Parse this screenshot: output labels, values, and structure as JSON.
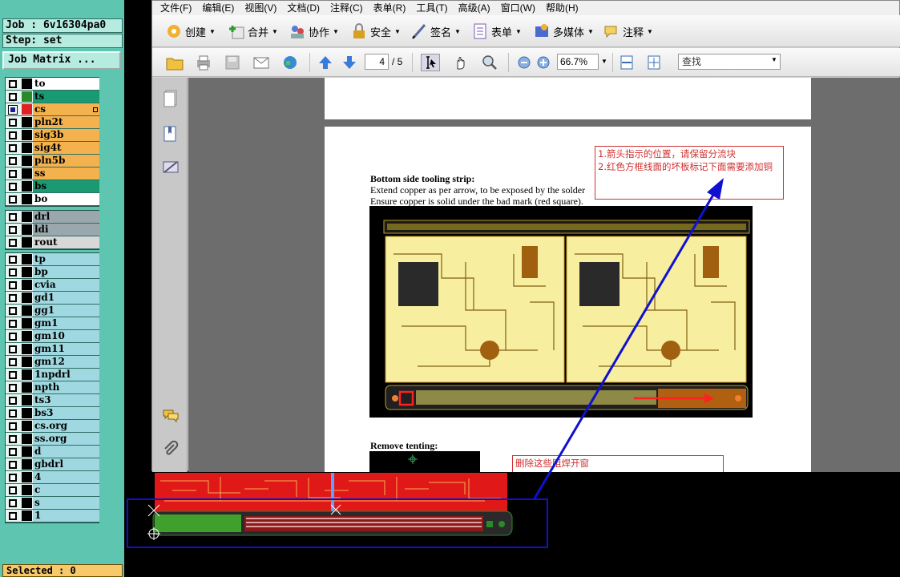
{
  "left_panel": {
    "job_label": "Job : 6v16304pa0",
    "step_label": "Step: set",
    "matrix_button": "Job Matrix ...",
    "groups": [
      [
        {
          "name": "to",
          "color": "#ffffff",
          "swatch": "#000000",
          "checked": false,
          "mark": false
        },
        {
          "name": "ts",
          "color": "#1a9a72",
          "swatch": "#2a8a2a",
          "checked": false,
          "mark": false
        },
        {
          "name": "cs",
          "color": "#f4b24e",
          "swatch": "#e02020",
          "checked": true,
          "mark": true
        },
        {
          "name": "pln2t",
          "color": "#f4b24e",
          "swatch": "#000000",
          "checked": false,
          "mark": false
        },
        {
          "name": "sig3b",
          "color": "#f4b24e",
          "swatch": "#000000",
          "checked": false,
          "mark": false
        },
        {
          "name": "sig4t",
          "color": "#f4b24e",
          "swatch": "#000000",
          "checked": false,
          "mark": false
        },
        {
          "name": "pln5b",
          "color": "#f4b24e",
          "swatch": "#000000",
          "checked": false,
          "mark": false
        },
        {
          "name": "ss",
          "color": "#f4b24e",
          "swatch": "#000000",
          "checked": false,
          "mark": false
        },
        {
          "name": "bs",
          "color": "#1a9a72",
          "swatch": "#000000",
          "checked": false,
          "mark": false
        },
        {
          "name": "bo",
          "color": "#ffffff",
          "swatch": "#000000",
          "checked": false,
          "mark": false
        }
      ],
      [
        {
          "name": "drl",
          "color": "#9aa8ae",
          "swatch": "#000000",
          "checked": false,
          "mark": false
        },
        {
          "name": "ldi",
          "color": "#9aa8ae",
          "swatch": "#000000",
          "checked": false,
          "mark": false
        },
        {
          "name": "rout",
          "color": "#d8d8d8",
          "swatch": "#000000",
          "checked": false,
          "mark": false
        }
      ],
      [
        {
          "name": "tp",
          "color": "#9fd8e0",
          "swatch": "#000000",
          "checked": false,
          "mark": false
        },
        {
          "name": "bp",
          "color": "#9fd8e0",
          "swatch": "#000000",
          "checked": false,
          "mark": false
        },
        {
          "name": "cvia",
          "color": "#9fd8e0",
          "swatch": "#000000",
          "checked": false,
          "mark": false
        },
        {
          "name": "gd1",
          "color": "#9fd8e0",
          "swatch": "#000000",
          "checked": false,
          "mark": false
        },
        {
          "name": "gg1",
          "color": "#9fd8e0",
          "swatch": "#000000",
          "checked": false,
          "mark": false
        },
        {
          "name": "gm1",
          "color": "#9fd8e0",
          "swatch": "#000000",
          "checked": false,
          "mark": false
        },
        {
          "name": "gm10",
          "color": "#9fd8e0",
          "swatch": "#000000",
          "checked": false,
          "mark": false
        },
        {
          "name": "gm11",
          "color": "#9fd8e0",
          "swatch": "#000000",
          "checked": false,
          "mark": false
        },
        {
          "name": "gm12",
          "color": "#9fd8e0",
          "swatch": "#000000",
          "checked": false,
          "mark": false
        },
        {
          "name": "1npdrl",
          "color": "#9fd8e0",
          "swatch": "#000000",
          "checked": false,
          "mark": false
        },
        {
          "name": "npth",
          "color": "#9fd8e0",
          "swatch": "#000000",
          "checked": false,
          "mark": false
        },
        {
          "name": "ts3",
          "color": "#9fd8e0",
          "swatch": "#000000",
          "checked": false,
          "mark": false
        },
        {
          "name": "bs3",
          "color": "#9fd8e0",
          "swatch": "#000000",
          "checked": false,
          "mark": false
        },
        {
          "name": "cs.org",
          "color": "#9fd8e0",
          "swatch": "#000000",
          "checked": false,
          "mark": false
        },
        {
          "name": "ss.org",
          "color": "#9fd8e0",
          "swatch": "#000000",
          "checked": false,
          "mark": false
        },
        {
          "name": "d",
          "color": "#9fd8e0",
          "swatch": "#000000",
          "checked": false,
          "mark": false
        },
        {
          "name": "gbdrl",
          "color": "#9fd8e0",
          "swatch": "#000000",
          "checked": false,
          "mark": false
        },
        {
          "name": "4",
          "color": "#9fd8e0",
          "swatch": "#000000",
          "checked": false,
          "mark": false
        },
        {
          "name": "c",
          "color": "#9fd8e0",
          "swatch": "#000000",
          "checked": false,
          "mark": false
        },
        {
          "name": "s",
          "color": "#9fd8e0",
          "swatch": "#000000",
          "checked": false,
          "mark": false
        },
        {
          "name": "1",
          "color": "#9fd8e0",
          "swatch": "#000000",
          "checked": false,
          "mark": false
        }
      ]
    ],
    "selected_label": "Selected : 0"
  },
  "reader": {
    "menu": [
      "文件(F)",
      "编辑(E)",
      "视图(V)",
      "文档(D)",
      "注释(C)",
      "表单(R)",
      "工具(T)",
      "高级(A)",
      "窗口(W)",
      "帮助(H)"
    ],
    "task_buttons": [
      {
        "label": "创建",
        "icon": "create-icon"
      },
      {
        "label": "合并",
        "icon": "combine-icon"
      },
      {
        "label": "协作",
        "icon": "collaborate-icon"
      },
      {
        "label": "安全",
        "icon": "lock-icon"
      },
      {
        "label": "签名",
        "icon": "pen-icon"
      },
      {
        "label": "表单",
        "icon": "form-icon"
      },
      {
        "label": "多媒体",
        "icon": "multimedia-icon"
      },
      {
        "label": "注释",
        "icon": "comment-icon"
      }
    ],
    "page_current": "4",
    "page_total": "/ 5",
    "zoom": "66.7%",
    "find_placeholder": "查找",
    "document": {
      "section1_title": "Bottom side tooling strip:",
      "section1_line1": "Extend copper as per arrow, to be exposed by the solder",
      "section1_line2": "Ensure copper is solid under the bad mark (red square).",
      "note1": "1.箭头指示的位置，请保留分流块",
      "note2": "2.红色方框线面的坏板标记下面需要添加铜",
      "section2_title": "Remove tenting:",
      "note3": "删除这些阻焊开窗"
    }
  },
  "colors": {
    "panel_bg": "#5ec6b0",
    "highlight_blue": "#1010d0",
    "annotation_red": "#d03030"
  }
}
